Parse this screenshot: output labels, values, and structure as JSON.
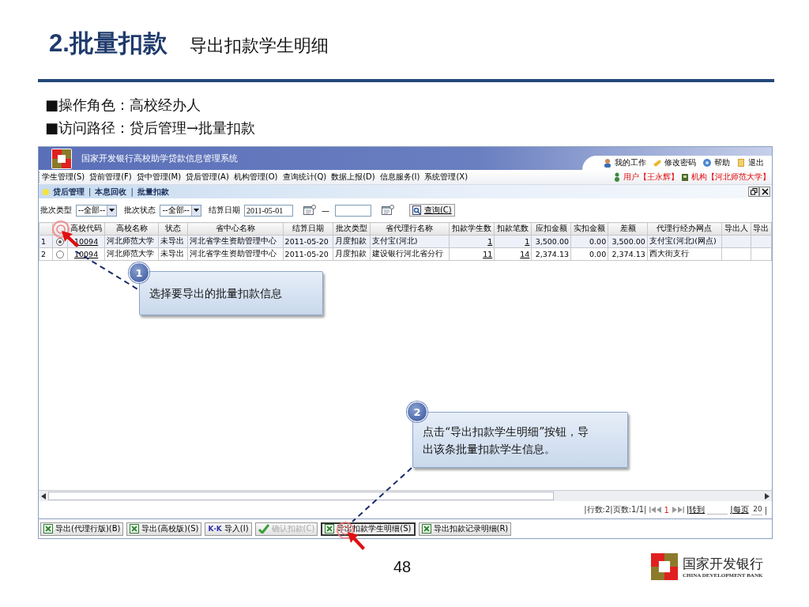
{
  "slide": {
    "title": "2.批量扣款",
    "subtitle": "导出扣款学生明细",
    "bullets": [
      "■操作角色：高校经办人",
      "■访问路径：贷后管理→批量扣款"
    ],
    "page_number": "48",
    "logo": {
      "name": "国家开发银行",
      "english": "CHINA DEVELOPMENT BANK"
    }
  },
  "app": {
    "title": "国家开发银行高校助学贷款信息管理系统",
    "top_links": [
      {
        "kind": "user",
        "label": "我的工作"
      },
      {
        "kind": "password",
        "label": "修改密码"
      },
      {
        "kind": "help",
        "label": "帮助"
      },
      {
        "kind": "exit",
        "label": "退出"
      }
    ],
    "menu": [
      "学生管理(S)",
      "贷前管理(F)",
      "贷中管理(M)",
      "贷后管理(A)",
      "机构管理(O)",
      "查询统计(Q)",
      "数据上报(D)",
      "信息服务(I)",
      "系统管理(X)"
    ],
    "user_info": [
      {
        "kind": "user",
        "label": "用户【王永辉】"
      },
      {
        "kind": "org",
        "label": "机构【河北师范大学】"
      }
    ],
    "breadcrumb": [
      "贷后管理",
      "|",
      "本息回收",
      "|",
      "批量扣款"
    ],
    "filters": [
      {
        "kind": "select",
        "label": "批次类型",
        "value": "--全部--"
      },
      {
        "kind": "select",
        "label": "批次状态",
        "value": "--全部--"
      },
      {
        "kind": "daterange",
        "label": "结算日期",
        "value": "2011-05-01",
        "separator": "—"
      }
    ],
    "query_button": "查询(C)",
    "table": {
      "columns": [
        "高校代码",
        "高校名称",
        "状态",
        "省中心名称",
        "结算日期",
        "批次类型",
        "省代理行名称",
        "扣款学生数",
        "扣款笔数",
        "应扣金额",
        "实扣金额",
        "差额",
        "代理行经办网点",
        "导出人",
        "导出"
      ],
      "rows": [
        {
          "number": "1",
          "selected": true,
          "cells": [
            "10094",
            "河北师范大学",
            "未导出",
            "河北省学生资助管理中心",
            "2011-05-20",
            "月度扣款",
            "支付宝(河北)",
            "1",
            "1",
            "3,500.00",
            "0.00",
            "3,500.00",
            "支付宝(河北)(网点)",
            "",
            ""
          ]
        },
        {
          "number": "2",
          "selected": false,
          "cells": [
            "10094",
            "河北师范大学",
            "未导出",
            "河北省学生资助管理中心",
            "2011-05-20",
            "月度扣款",
            "建设银行河北省分行",
            "11",
            "14",
            "2,374.13",
            "0.00",
            "2,374.13",
            "西大街支行",
            "",
            ""
          ]
        }
      ]
    },
    "pagination": {
      "summary": "|行数:2|页数:1/1|",
      "page": "1",
      "goto": "|转到",
      "per_page_label": "|每页",
      "per_page": "20",
      "end": "|"
    },
    "buttons": [
      {
        "kind": "excel",
        "label": "导出(代理行版)(B)",
        "disabled": false,
        "pressed": false
      },
      {
        "kind": "excel",
        "label": "导出(高校版)(S)",
        "disabled": false,
        "pressed": false
      },
      {
        "kind": "import",
        "label": "导入(I)",
        "icon_text": "K·K",
        "disabled": false,
        "pressed": false
      },
      {
        "kind": "check",
        "label": "确认扣款(C)",
        "disabled": true,
        "pressed": false
      },
      {
        "kind": "excel",
        "label": "导出扣款学生明细(S)",
        "disabled": false,
        "pressed": true
      },
      {
        "kind": "excel",
        "label": "导出扣款记录明细(R)",
        "disabled": false,
        "pressed": false
      }
    ]
  },
  "callouts": [
    {
      "number": "1",
      "text": "选择要导出的批量扣款信息"
    },
    {
      "number": "2",
      "text": "点击“导出扣款学生明细”按钮，导出该条批量扣款学生信息。"
    }
  ]
}
